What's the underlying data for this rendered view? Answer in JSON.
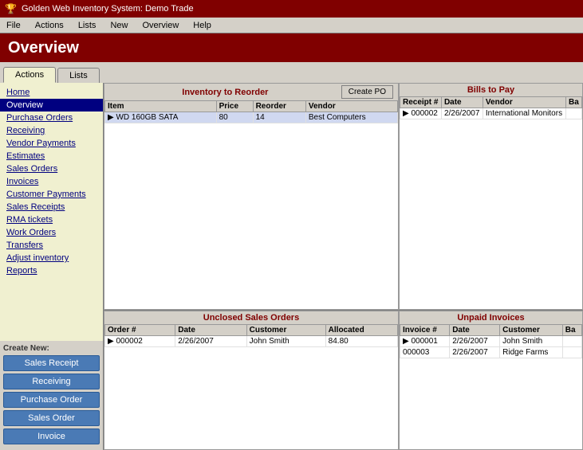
{
  "titleBar": {
    "icon": "golden-web-icon",
    "title": "Golden Web Inventory System: Demo Trade"
  },
  "menuBar": {
    "items": [
      "File",
      "Actions",
      "Lists",
      "New",
      "Overview",
      "Help"
    ]
  },
  "pageTitle": "Overview",
  "tabs": [
    {
      "label": "Actions",
      "active": true
    },
    {
      "label": "Lists",
      "active": false
    }
  ],
  "sidebar": {
    "createNewLabel": "Create New:",
    "navItems": [
      {
        "label": "Home",
        "active": false
      },
      {
        "label": "Overview",
        "active": true
      },
      {
        "label": "Purchase Orders",
        "active": false
      },
      {
        "label": "Receiving",
        "active": false
      },
      {
        "label": "Vendor Payments",
        "active": false
      },
      {
        "label": "Estimates",
        "active": false
      },
      {
        "label": "Sales Orders",
        "active": false
      },
      {
        "label": "Invoices",
        "active": false
      },
      {
        "label": "Customer Payments",
        "active": false
      },
      {
        "label": "Sales Receipts",
        "active": false
      },
      {
        "label": "RMA tickets",
        "active": false
      },
      {
        "label": "Work Orders",
        "active": false
      },
      {
        "label": "Transfers",
        "active": false
      },
      {
        "label": "Adjust inventory",
        "active": false
      },
      {
        "label": "Reports",
        "active": false
      }
    ],
    "createButtons": [
      "Sales Receipt",
      "Receiving",
      "Purchase Order",
      "Sales Order",
      "Invoice"
    ]
  },
  "inventoryPanel": {
    "title": "Inventory to Reorder",
    "createPOLabel": "Create PO",
    "columns": [
      "Item",
      "Price",
      "Reorder",
      "Vendor"
    ],
    "rows": [
      {
        "item": "WD 160GB SATA",
        "price": "80",
        "reorder": "14",
        "vendor": "Best Computers"
      }
    ]
  },
  "billsPanel": {
    "title": "Bills to Pay",
    "columns": [
      "Receipt #",
      "Date",
      "Vendor",
      "Ba"
    ],
    "rows": [
      {
        "receipt": "000002",
        "date": "2/26/2007",
        "vendor": "International Monitors",
        "ba": ""
      }
    ]
  },
  "salesOrdersPanel": {
    "title": "Unclosed Sales Orders",
    "columns": [
      "Order #",
      "Date",
      "Customer",
      "Allocated"
    ],
    "rows": [
      {
        "order": "000002",
        "date": "2/26/2007",
        "customer": "John Smith",
        "allocated": "84.80"
      }
    ]
  },
  "unpaidInvoicesPanel": {
    "title": "Unpaid Invoices",
    "columns": [
      "Invoice #",
      "Date",
      "Customer",
      "Ba"
    ],
    "rows": [
      {
        "invoice": "000001",
        "date": "2/26/2007",
        "customer": "John Smith",
        "ba": ""
      },
      {
        "invoice": "000003",
        "date": "2/26/2007",
        "customer": "Ridge Farms",
        "ba": ""
      }
    ]
  }
}
